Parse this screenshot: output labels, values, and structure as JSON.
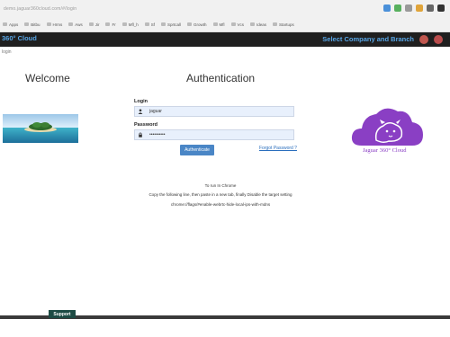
{
  "browser": {
    "url": "demo.jaguar360cloud.com/#/login",
    "bookmarks": [
      "Apps",
      "Bitbu",
      "Hrms",
      "Aws",
      "Jir",
      "Fr",
      "Mfl_h",
      "Sf",
      "Sprtcall",
      "Growth",
      "Mfl",
      "Vcs",
      "Ideas",
      "Startups"
    ]
  },
  "header": {
    "app_title": "360° Cloud",
    "company_link": "Select Company and Branch",
    "sub_label": "login"
  },
  "welcome": {
    "title": "Welcome"
  },
  "auth": {
    "title": "Authentication",
    "login_label": "Login",
    "login_value": "jaguar",
    "password_label": "Password",
    "password_value": "••••••••••",
    "authenticate_button": "Authenticate",
    "forgot_link": "Forgot Password ?"
  },
  "logo": {
    "text": "Jaguar 360° Cloud",
    "color": "#8a3fc4"
  },
  "instructions": {
    "line1": "To run In Chrome",
    "line2": "Copy the following line, then paste in a new tab, finally Disable the target setting",
    "line3": "chrome://flags/#enable-webrtc-hide-local-ips-with-mdns"
  },
  "footer": {
    "support": "Support"
  },
  "colors": {
    "header_bg": "#1f1f1f",
    "accent": "#58a6e6",
    "button": "#4a86c6",
    "support_bg": "#1d4b44"
  }
}
